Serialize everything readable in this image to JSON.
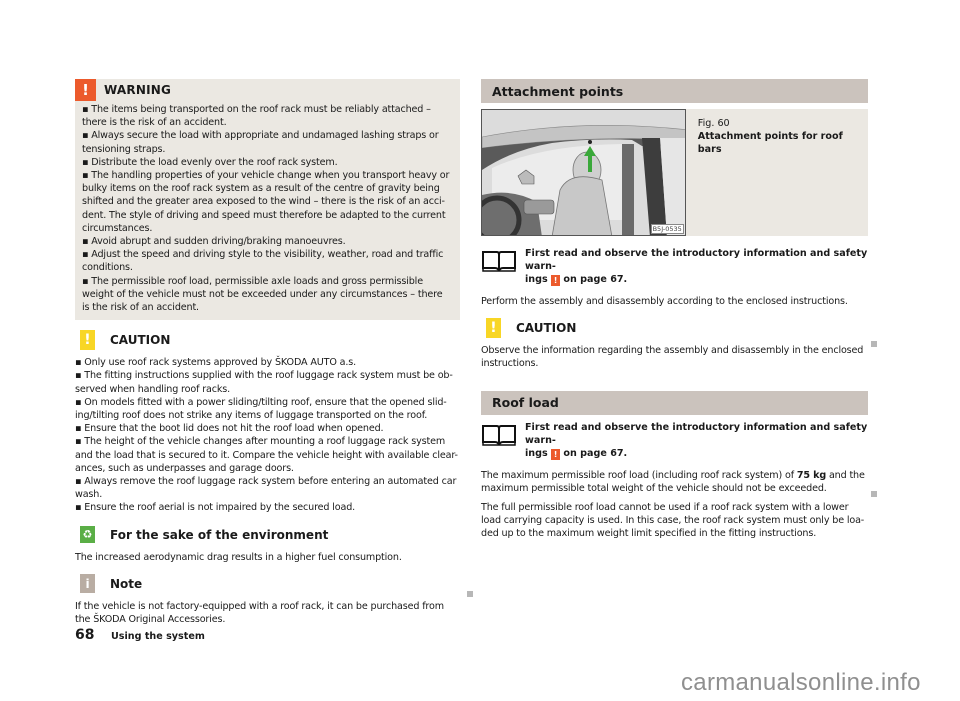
{
  "left": {
    "warning": {
      "icon": "warning-exclamation-icon",
      "title": "WARNING",
      "lines": [
        "▪ The items being transported on the roof rack must be reliably attached –",
        "there is the risk of an accident.",
        "▪ Always secure the load with appropriate and undamaged lashing straps or",
        "tensioning straps.",
        "▪ Distribute the load evenly over the roof rack system.",
        "▪ The handling properties of your vehicle change when you transport heavy or",
        "bulky items on the roof rack system as a result of the centre of gravity being",
        "shifted and the greater area exposed to the wind – there is the risk of an acci-",
        "dent. The style of driving and speed must therefore be adapted to the current",
        "circumstances.",
        "▪ Avoid abrupt and sudden driving/braking manoeuvres.",
        "▪ Adjust the speed and driving style to the visibility, weather, road and traffic",
        "conditions.",
        "▪ The permissible roof load, permissible axle loads and gross permissible",
        "weight of the vehicle must not be exceeded under any circumstances – there",
        "is the risk of an accident."
      ]
    },
    "caution": {
      "icon": "caution-exclamation-icon",
      "title": "CAUTION",
      "lines": [
        "▪ Only use roof rack systems approved by ŠKODA AUTO a.s.",
        "▪ The fitting instructions supplied with the roof luggage rack system must be ob-",
        "served when handling roof racks.",
        "▪ On models fitted with a power sliding/tilting roof, ensure that the opened slid-",
        "ing/tilting roof does not strike any items of luggage transported on the roof.",
        "▪ Ensure that the boot lid does not hit the roof load when opened.",
        "▪ The height of the vehicle changes after mounting a roof luggage rack system",
        "and the load that is secured to it. Compare the vehicle height with available clear-",
        "ances, such as underpasses and garage doors.",
        "▪ Always remove the roof luggage rack system before entering an automated car",
        "wash.",
        "▪ Ensure the roof aerial is not impaired by the secured load."
      ]
    },
    "environment": {
      "icon": "environment-recycle-icon",
      "title": "For the sake of the environment",
      "lines": [
        "The increased aerodynamic drag results in a higher fuel consumption."
      ]
    },
    "note": {
      "icon": "info-note-icon",
      "title": "Note",
      "lines": [
        "If the vehicle is not factory-equipped with a roof rack, it can be purchased from",
        "the ŠKODA Original Accessories."
      ]
    }
  },
  "right": {
    "attachment": {
      "heading": "Attachment points",
      "figure": {
        "label": "Fig. 60",
        "caption": "Attachment points for roof bars",
        "code": "B5J-0535"
      },
      "read_first": {
        "line1": "First read and observe the introductory information and safety warn-",
        "line2_pre": "ings",
        "warn_glyph": "!",
        "line2_post": "on page 67."
      },
      "paragraph": "Perform the assembly and disassembly according to the enclosed instructions.",
      "caution": {
        "title": "CAUTION",
        "lines": [
          "Observe the information regarding the assembly and disassembly in the enclosed",
          "instructions."
        ]
      }
    },
    "roof_load": {
      "heading": "Roof load",
      "read_first": {
        "line1": "First read and observe the introductory information and safety warn-",
        "line2_pre": "ings",
        "warn_glyph": "!",
        "line2_post": "on page 67."
      },
      "para1": {
        "pre": "The maximum permissible roof load (including roof rack system) of ",
        "bold": "75 kg",
        "post": " and the",
        "line2": "maximum permissible total weight of the vehicle should not be exceeded."
      },
      "para2_lines": [
        "The full permissible roof load cannot be used if a roof rack system with a lower",
        "load carrying capacity is used. In this case, the roof rack system must only be loa-",
        "ded up to the maximum weight limit specified in the fitting instructions."
      ]
    }
  },
  "footer": {
    "page_number": "68",
    "section_title": "Using the system"
  },
  "watermark": "carmanualsonline.info"
}
